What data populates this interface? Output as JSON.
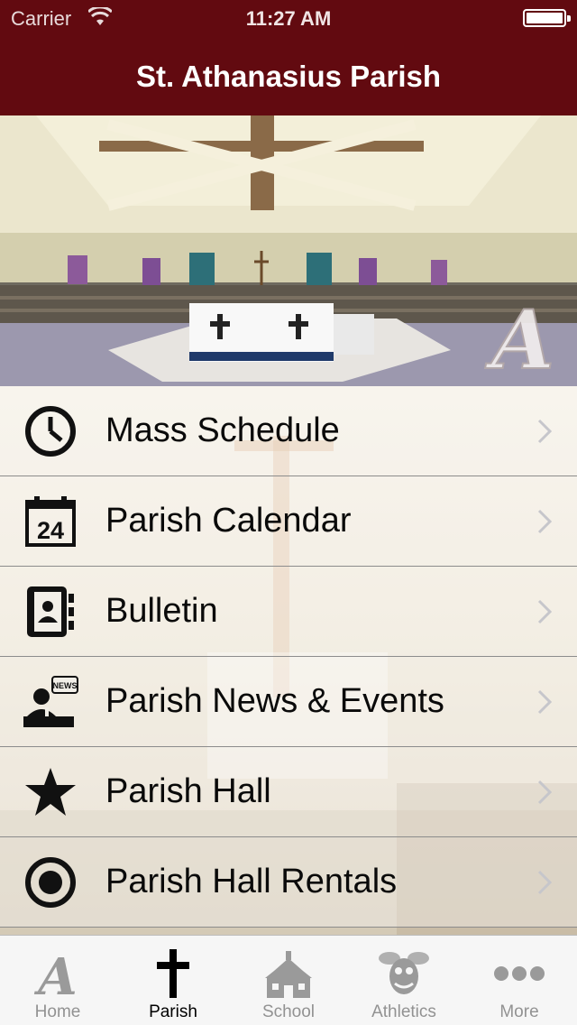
{
  "status_bar": {
    "carrier": "Carrier",
    "time": "11:27 AM",
    "battery_level": 1.0
  },
  "nav": {
    "title": "St. Athanasius Parish"
  },
  "hero": {
    "logo_letter": "A"
  },
  "menu": {
    "items": [
      {
        "label": "Mass Schedule",
        "icon": "clock-icon"
      },
      {
        "label": "Parish Calendar",
        "icon": "calendar-icon",
        "icon_text": "24"
      },
      {
        "label": "Bulletin",
        "icon": "contact-book-icon"
      },
      {
        "label": "Parish News & Events",
        "icon": "news-anchor-icon",
        "icon_text": "NEWS"
      },
      {
        "label": "Parish Hall",
        "icon": "star-icon"
      },
      {
        "label": "Parish Hall Rentals",
        "icon": "radio-button-icon"
      }
    ]
  },
  "tabs": {
    "items": [
      {
        "label": "Home",
        "icon": "script-a-icon",
        "active": false,
        "icon_text": "A"
      },
      {
        "label": "Parish",
        "icon": "cross-icon",
        "active": true
      },
      {
        "label": "School",
        "icon": "schoolhouse-icon",
        "active": false
      },
      {
        "label": "Athletics",
        "icon": "hornet-mascot-icon",
        "active": false
      },
      {
        "label": "More",
        "icon": "more-dots-icon",
        "active": false
      }
    ]
  },
  "colors": {
    "nav_background": "#620a10",
    "tab_active": "#000000",
    "tab_inactive": "#929292"
  }
}
